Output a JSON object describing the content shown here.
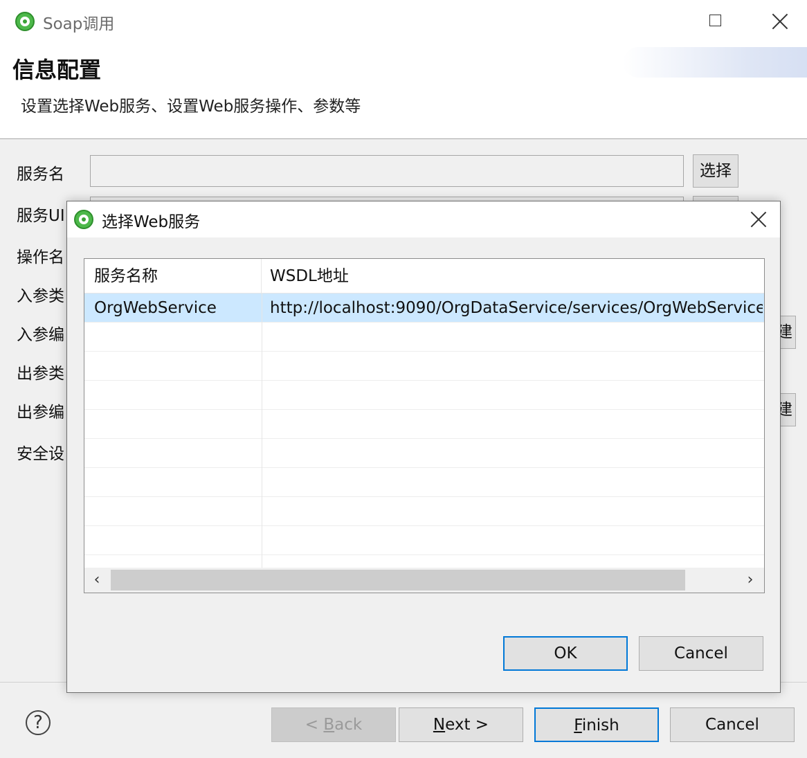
{
  "window": {
    "title": "Soap调用",
    "header_title": "信息配置",
    "header_desc": "设置选择Web服务、设置Web服务操作、参数等"
  },
  "form": {
    "service_name_label": "服务名",
    "select_button": "选择",
    "labels": [
      "服务UI",
      "操作名",
      "入参类",
      "入参编",
      "出参类",
      "出参编",
      "安全设"
    ],
    "side_button_fragment": "建"
  },
  "dialog": {
    "title": "选择Web服务",
    "columns": [
      "服务名称",
      "WSDL地址"
    ],
    "rows": [
      {
        "name": "OrgWebService",
        "wsdl": "http://localhost:9090/OrgDataService/services/OrgWebService"
      }
    ],
    "ok_label": "OK",
    "cancel_label": "Cancel"
  },
  "footer": {
    "help_label": "?",
    "back_label": "< Back",
    "next_label": "Next >",
    "finish_label": "Finish",
    "cancel_label": "Cancel"
  }
}
